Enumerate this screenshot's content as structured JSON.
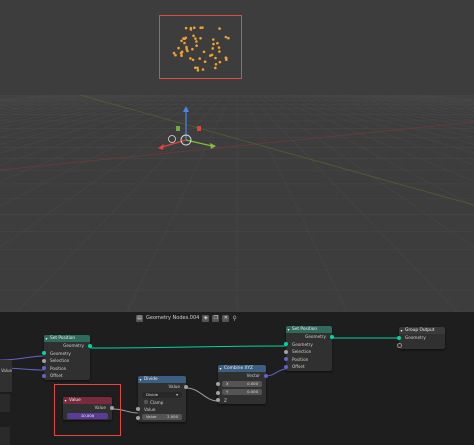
{
  "editor": {
    "title": "Geometry Nodes.004"
  },
  "nodes": {
    "set_position_1": {
      "title": "Set Position",
      "output": "Geometry",
      "inputs": [
        "Geometry",
        "Selection",
        "Position",
        "Offset"
      ]
    },
    "set_position_2": {
      "title": "Set Position",
      "output": "Geometry",
      "inputs": [
        "Geometry",
        "Selection",
        "Position",
        "Offset"
      ]
    },
    "group_output": {
      "title": "Group Output",
      "input": "Geometry"
    },
    "value": {
      "title": "Value",
      "output": "Value",
      "field_value": "10.000"
    },
    "divide": {
      "title": "Divide",
      "output": "Value",
      "operation": "Divide",
      "clamp_label": "Clamp",
      "input_label": "Value",
      "field_label": "Value",
      "field_value": "2.000"
    },
    "combine_xyz": {
      "title": "Combine XYZ",
      "output": "Vector",
      "x_label": "X",
      "x_value": "0.000",
      "y_label": "Y",
      "y_value": "0.000",
      "z_label": "Z"
    },
    "left_stub": {
      "label": "Value"
    }
  },
  "gizmo": {
    "axis_x": "#e0433c",
    "axis_y": "#6fae3a",
    "axis_z": "#4a86e8"
  },
  "colors": {
    "highlight": "#e04a3f",
    "points": "#f0a030",
    "geometry_socket": "#00d6a3"
  }
}
